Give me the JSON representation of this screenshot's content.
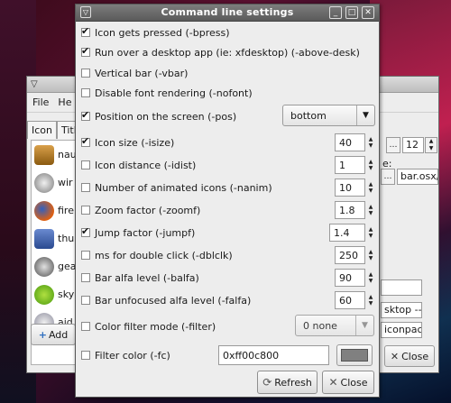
{
  "dialog": {
    "title": "Command line settings",
    "options": [
      {
        "label": "Icon gets pressed (-bpress)",
        "checked": true
      },
      {
        "label": "Run over a desktop app (ie: xfdesktop) (-above-desk)",
        "checked": true
      },
      {
        "label": "Vertical bar (-vbar)",
        "checked": false
      },
      {
        "label": "Disable font rendering (-nofont)",
        "checked": false
      },
      {
        "label": "Position on the screen (-pos)",
        "checked": true
      },
      {
        "label": "Icon size (-isize)",
        "checked": true
      },
      {
        "label": "Icon distance (-idist)",
        "checked": false
      },
      {
        "label": "Number of animated icons (-nanim)",
        "checked": false
      },
      {
        "label": "Zoom factor (-zoomf)",
        "checked": false
      },
      {
        "label": "Jump factor (-jumpf)",
        "checked": true
      },
      {
        "label": "ms for double click (-dblclk)",
        "checked": false
      },
      {
        "label": "Bar alfa level (-balfa)",
        "checked": false
      },
      {
        "label": "Bar unfocused alfa level (-falfa)",
        "checked": false
      },
      {
        "label": "Color filter mode (-filter)",
        "checked": false
      },
      {
        "label": "Filter color (-fc)",
        "checked": false
      }
    ],
    "position_value": "bottom",
    "isize_value": "40",
    "idist_value": "1",
    "nanim_value": "10",
    "zoomf_value": "1.8",
    "jumpf_value": "1.4",
    "dblclk_value": "250",
    "balfa_value": "90",
    "falfa_value": "60",
    "filter_value": "0 none",
    "fc_value": "0xff00c800",
    "refresh_label": "Refresh",
    "close_label": "Close"
  },
  "background_window": {
    "menu": [
      "File",
      "He"
    ],
    "tabs": [
      "Icon",
      "Titl"
    ],
    "list_items": [
      "nau",
      "wir",
      "fire",
      "thu",
      "gea",
      "sky",
      "aid"
    ],
    "field_value_12": "12",
    "label_e": "e:",
    "path_field": "bar.osx/",
    "field_desktop": "sktop --",
    "field_iconpac": "iconpac",
    "add_label": "Add",
    "close_label": "Close"
  },
  "colors": {
    "filter_swatch": "#808080",
    "titlebar": "#6b6b6b"
  }
}
